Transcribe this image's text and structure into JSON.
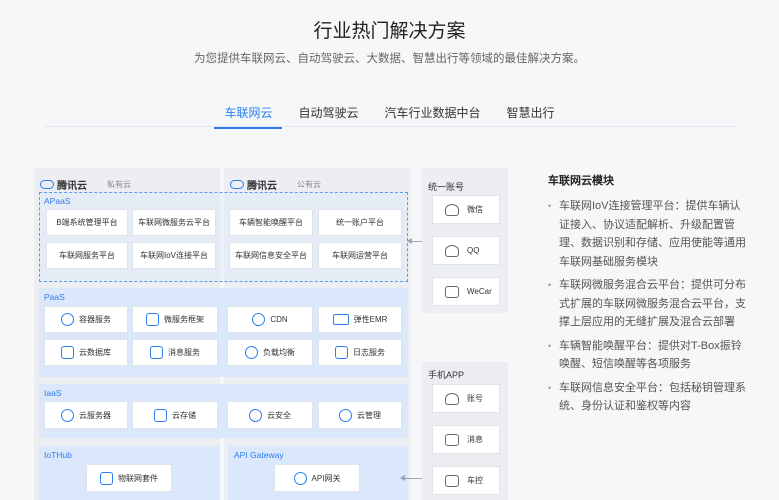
{
  "header": {
    "title": "行业热门解决方案",
    "subtitle": "为您提供车联网云、自动驾驶云、大数据、智慧出行等领域的最佳解决方案。"
  },
  "tabs": [
    {
      "label": "车联网云",
      "active": true
    },
    {
      "label": "自动驾驶云",
      "active": false
    },
    {
      "label": "汽车行业数据中台",
      "active": false
    },
    {
      "label": "智慧出行",
      "active": false
    }
  ],
  "diagram": {
    "private_cloud": {
      "brand": "腾讯云",
      "kind": "私有云"
    },
    "public_cloud": {
      "brand": "腾讯云",
      "kind": "公有云"
    },
    "apaas": {
      "label": "APaaS",
      "items": [
        "B端系统管理平台",
        "车联网微服务云平台",
        "车辆智能唤醒平台",
        "统一账户平台",
        "车联网服务平台",
        "车联网IoV连接平台",
        "车联网信息安全平台",
        "车联网运营平台"
      ]
    },
    "paas": {
      "label": "PaaS",
      "items": [
        "容器服务",
        "微服务框架",
        "CDN",
        "弹性EMR",
        "云数据库",
        "消息服务",
        "负载均衡",
        "日志服务"
      ]
    },
    "iaas": {
      "label": "IaaS",
      "items": [
        "云服务器",
        "云存储",
        "云安全",
        "云管理"
      ]
    },
    "iothub": {
      "label": "IoTHub",
      "items": [
        "物联网套件"
      ]
    },
    "api_gateway": {
      "label": "API Gateway",
      "items": [
        "API网关"
      ]
    },
    "unified_account": {
      "title": "统一账号",
      "items": [
        {
          "label": "微信",
          "icon": "person-icon"
        },
        {
          "label": "QQ",
          "icon": "person-icon"
        },
        {
          "label": "WeCar",
          "icon": "tablet-icon"
        }
      ]
    },
    "mobile_app": {
      "title": "手机APP",
      "items": [
        {
          "label": "账号",
          "icon": "person-icon"
        },
        {
          "label": "消息",
          "icon": "phone-icon"
        },
        {
          "label": "车控",
          "icon": "car-icon"
        }
      ]
    },
    "accent_color": "#2a7ef0"
  },
  "module": {
    "title": "车联网云模块",
    "items": [
      "车联网IoV连接管理平台：提供车辆认证接入、协议适配解析、升级配置管理、数据识别和存储、应用使能等通用车联网基础服务模块",
      "车联网微服务混合云平台：提供可分布式扩展的车联网微服务混合云平台，支撑上层应用的无缝扩展及混合云部署",
      "车辆智能唤醒平台：提供对T-Box振铃唤醒、短信唤醒等各项服务",
      "车联网信息安全平台：包括秘钥管理系统、身份认证和鉴权等内容"
    ]
  }
}
